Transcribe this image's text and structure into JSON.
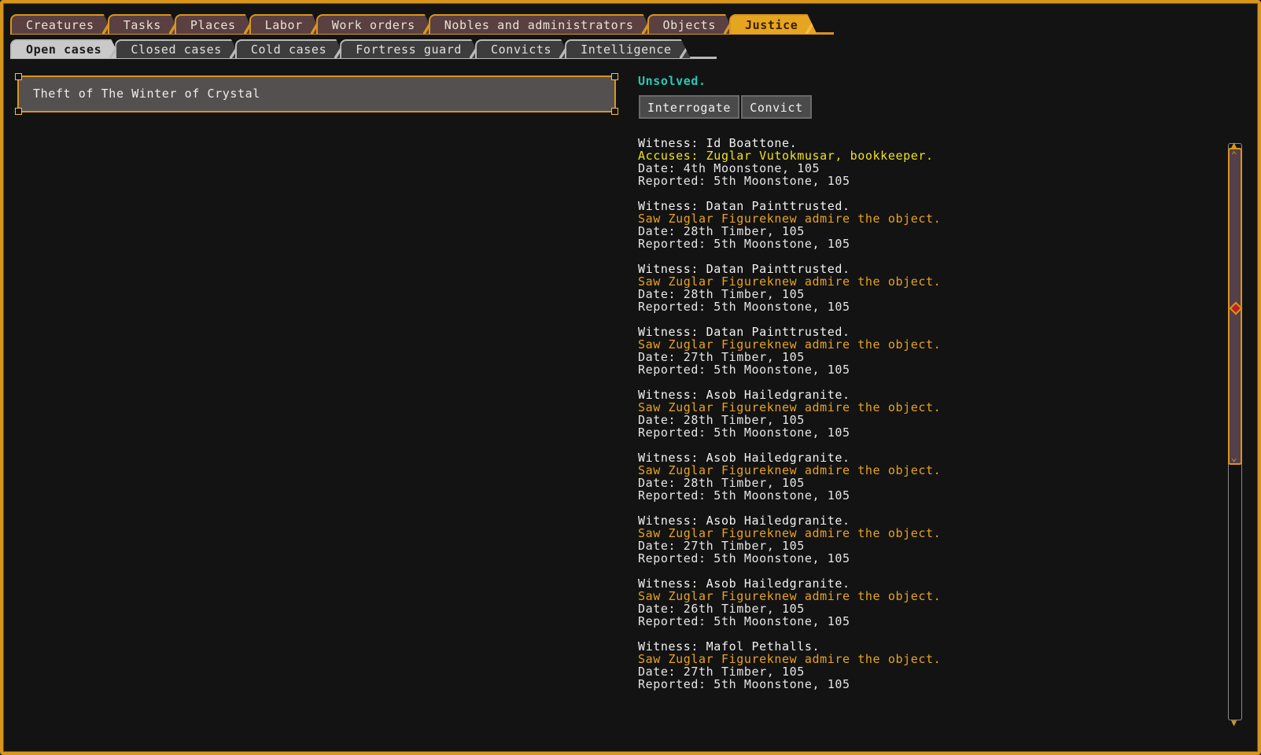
{
  "tabs_main": [
    {
      "label": "Creatures",
      "active": false
    },
    {
      "label": "Tasks",
      "active": false
    },
    {
      "label": "Places",
      "active": false
    },
    {
      "label": "Labor",
      "active": false
    },
    {
      "label": "Work orders",
      "active": false
    },
    {
      "label": "Nobles and administrators",
      "active": false
    },
    {
      "label": "Objects",
      "active": false
    },
    {
      "label": "Justice",
      "active": true
    }
  ],
  "tabs_sub": [
    {
      "label": "Open cases",
      "active": true
    },
    {
      "label": "Closed cases",
      "active": false
    },
    {
      "label": "Cold cases",
      "active": false
    },
    {
      "label": "Fortress guard",
      "active": false
    },
    {
      "label": "Convicts",
      "active": false
    },
    {
      "label": "Intelligence",
      "active": false
    }
  ],
  "case": {
    "title": "Theft of The Winter of Crystal"
  },
  "status": "Unsolved.",
  "buttons": {
    "interrogate": "Interrogate",
    "convict": "Convict"
  },
  "witnesses": [
    {
      "witness": "Witness: Id Boattone.",
      "testimony": "Accuses: Zuglar Vutokmusar, bookkeeper.",
      "type": "accuse",
      "date": "Date: 4th Moonstone, 105",
      "reported": "Reported: 5th Moonstone, 105"
    },
    {
      "witness": "Witness: Datan Painttrusted.",
      "testimony": "Saw Zuglar Figureknew admire the object.",
      "type": "saw",
      "date": "Date: 28th Timber, 105",
      "reported": "Reported: 5th Moonstone, 105"
    },
    {
      "witness": "Witness: Datan Painttrusted.",
      "testimony": "Saw Zuglar Figureknew admire the object.",
      "type": "saw",
      "date": "Date: 28th Timber, 105",
      "reported": "Reported: 5th Moonstone, 105"
    },
    {
      "witness": "Witness: Datan Painttrusted.",
      "testimony": "Saw Zuglar Figureknew admire the object.",
      "type": "saw",
      "date": "Date: 27th Timber, 105",
      "reported": "Reported: 5th Moonstone, 105"
    },
    {
      "witness": "Witness: Asob Hailedgranite.",
      "testimony": "Saw Zuglar Figureknew admire the object.",
      "type": "saw",
      "date": "Date: 28th Timber, 105",
      "reported": "Reported: 5th Moonstone, 105"
    },
    {
      "witness": "Witness: Asob Hailedgranite.",
      "testimony": "Saw Zuglar Figureknew admire the object.",
      "type": "saw",
      "date": "Date: 28th Timber, 105",
      "reported": "Reported: 5th Moonstone, 105"
    },
    {
      "witness": "Witness: Asob Hailedgranite.",
      "testimony": "Saw Zuglar Figureknew admire the object.",
      "type": "saw",
      "date": "Date: 27th Timber, 105",
      "reported": "Reported: 5th Moonstone, 105"
    },
    {
      "witness": "Witness: Asob Hailedgranite.",
      "testimony": "Saw Zuglar Figureknew admire the object.",
      "type": "saw",
      "date": "Date: 26th Timber, 105",
      "reported": "Reported: 5th Moonstone, 105"
    },
    {
      "witness": "Witness: Mafol Pethalls.",
      "testimony": "Saw Zuglar Figureknew admire the object.",
      "type": "saw",
      "date": "Date: 27th Timber, 105",
      "reported": "Reported: 5th Moonstone, 105"
    }
  ],
  "colors": {
    "accent": "#d8951c",
    "status": "#2ac9b4",
    "accuse": "#f0e020",
    "testimony": "#e8a31e"
  },
  "icons": {
    "scroll_up": "arrow-up-icon",
    "scroll_down": "arrow-down-icon",
    "thumb_grip": "diamond-grip-icon"
  }
}
